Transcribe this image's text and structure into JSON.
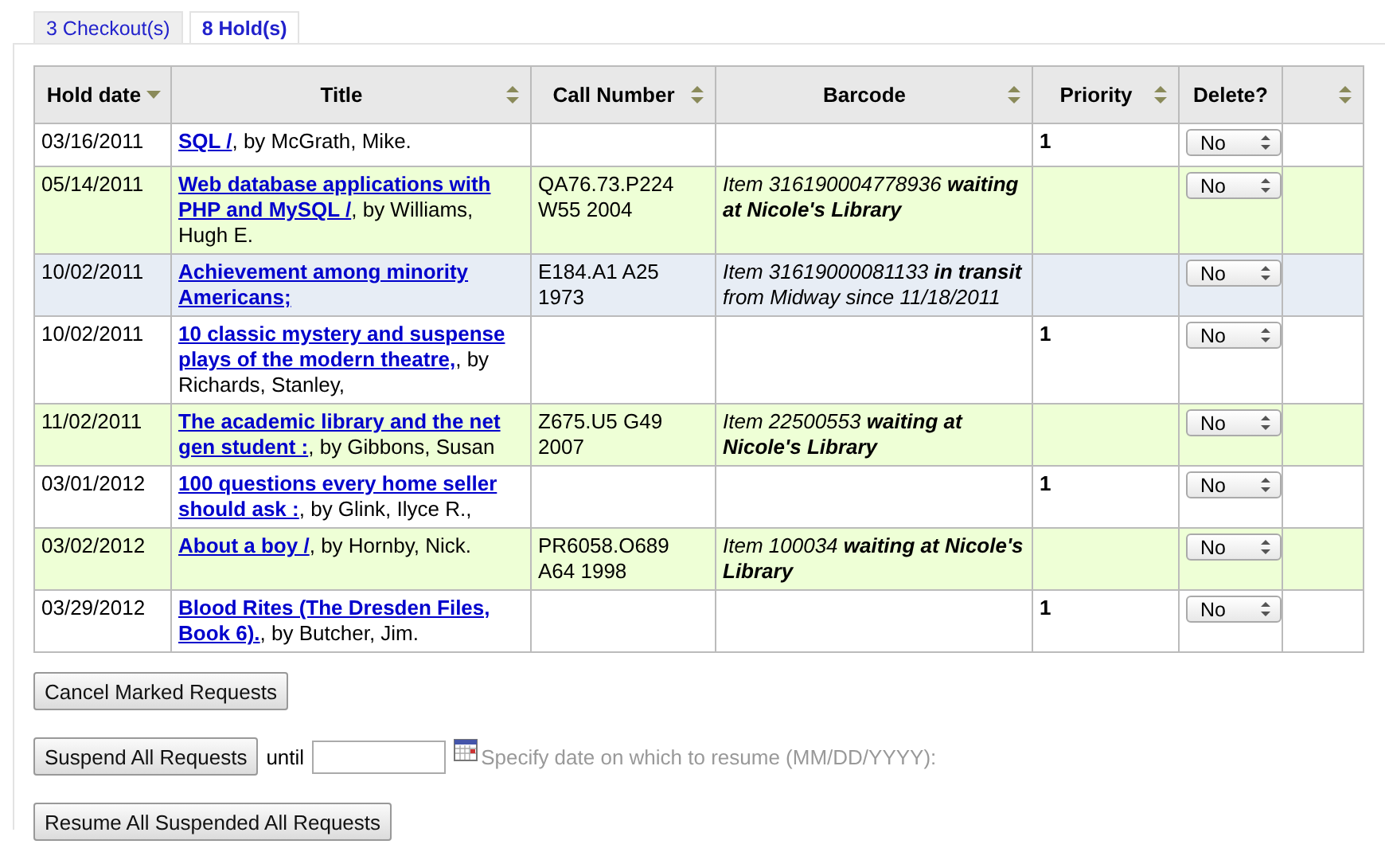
{
  "tabs": [
    {
      "label": "3 Checkout(s)",
      "selected": false
    },
    {
      "label": "8 Hold(s)",
      "selected": true
    }
  ],
  "table": {
    "columns": [
      {
        "label": "Hold date",
        "sortable": true,
        "sorted": true
      },
      {
        "label": "Title",
        "sortable": true,
        "sorted": false
      },
      {
        "label": "Call Number",
        "sortable": true,
        "sorted": false
      },
      {
        "label": "Barcode",
        "sortable": true,
        "sorted": false
      },
      {
        "label": "Priority",
        "sortable": true,
        "sorted": false
      },
      {
        "label": "Delete?",
        "sortable": false
      },
      {
        "sortable": true,
        "sorted": false
      }
    ],
    "rows": [
      {
        "color": "#ffffff",
        "hold_date": "03/16/2011",
        "title": "SQL /",
        "author": ", by McGrath, Mike.",
        "priority": "1",
        "delete": "No"
      },
      {
        "color": "#eeffd6",
        "hold_date": "05/14/2011",
        "title": "Web database applications with PHP and MySQL /",
        "author": ", by Williams, Hugh E.",
        "call_number": "QA76.73.P224 W55 2004",
        "barcode": "Item 316190004778936 **waiting at Nicole's Library**",
        "delete": "No"
      },
      {
        "color": "#e7edf5",
        "hold_date": "10/02/2011",
        "title": "Achievement among minority Americans;",
        "call_number": "E184.A1 A25 1973",
        "barcode": "Item 31619000081133 **in transit** from Midway since 11/18/2011",
        "delete": "No"
      },
      {
        "color": "#ffffff",
        "hold_date": "10/02/2011",
        "title": "10 classic mystery and suspense plays of the modern theatre,",
        "author": ", by Richards, Stanley,",
        "priority": "1",
        "delete": "No"
      },
      {
        "color": "#eeffd6",
        "hold_date": "11/02/2011",
        "title": "The academic library and the net gen student :",
        "author": ", by Gibbons, Susan",
        "call_number": "Z675.U5 G49 2007",
        "barcode": "Item 22500553 **waiting at Nicole's Library**",
        "delete": "No"
      },
      {
        "color": "#ffffff",
        "hold_date": "03/01/2012",
        "title": "100 questions every home seller should ask :",
        "author": ", by Glink, Ilyce R.,",
        "priority": "1",
        "delete": "No"
      },
      {
        "color": "#eeffd6",
        "hold_date": "03/02/2012",
        "title": "About a boy /",
        "author": ", by Hornby, Nick.",
        "call_number": "PR6058.O689 A64 1998",
        "barcode": "Item 100034 **waiting at Nicole's Library**",
        "delete": "No"
      },
      {
        "color": "#ffffff",
        "hold_date": "03/29/2012",
        "title": "Blood Rites (The Dresden Files, Book 6).",
        "author": ", by Butcher, Jim.",
        "priority": "1",
        "delete": "No"
      }
    ]
  },
  "cancel_button": "Cancel Marked Requests",
  "suspend": {
    "button": "Suspend All Requests",
    "until": "until",
    "hint": "Specify date on which to resume (MM/DD/YYYY):"
  },
  "resume_button": "Resume All Suspended All Requests"
}
